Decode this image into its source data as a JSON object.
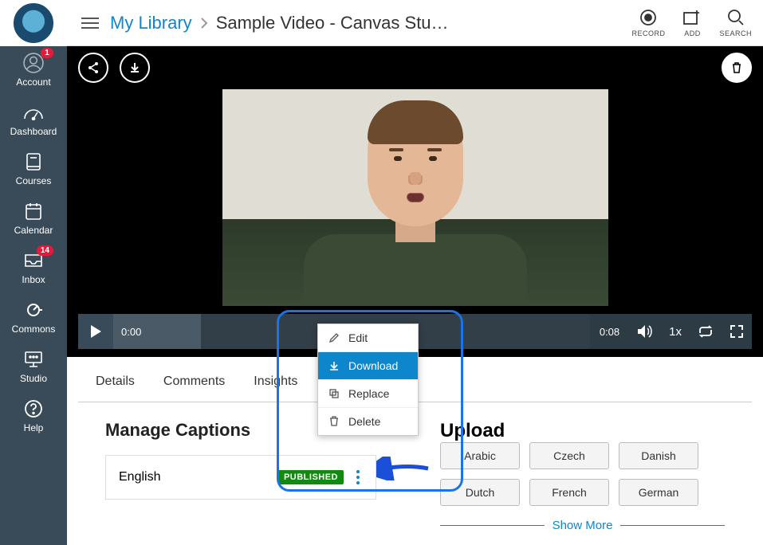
{
  "nav": {
    "account": "Account",
    "account_badge": "1",
    "dashboard": "Dashboard",
    "courses": "Courses",
    "calendar": "Calendar",
    "inbox": "Inbox",
    "inbox_badge": "14",
    "commons": "Commons",
    "studio": "Studio",
    "help": "Help"
  },
  "breadcrumb": {
    "library": "My Library",
    "current": "Sample Video - Canvas Stu…"
  },
  "header_actions": {
    "record": "RECORD",
    "add": "ADD",
    "search": "SEARCH"
  },
  "video": {
    "current_time": "0:00",
    "duration": "0:08",
    "speed": "1x"
  },
  "tabs": {
    "details": "Details",
    "comments": "Comments",
    "insights": "Insights"
  },
  "captions": {
    "heading": "Manage Captions",
    "language": "English",
    "status": "PUBLISHED"
  },
  "upload": {
    "heading": "Upload",
    "languages": [
      "Arabic",
      "Czech",
      "Danish",
      "Dutch",
      "French",
      "German"
    ],
    "show_more": "Show More"
  },
  "dropdown": {
    "edit": "Edit",
    "download": "Download",
    "replace": "Replace",
    "delete": "Delete"
  }
}
